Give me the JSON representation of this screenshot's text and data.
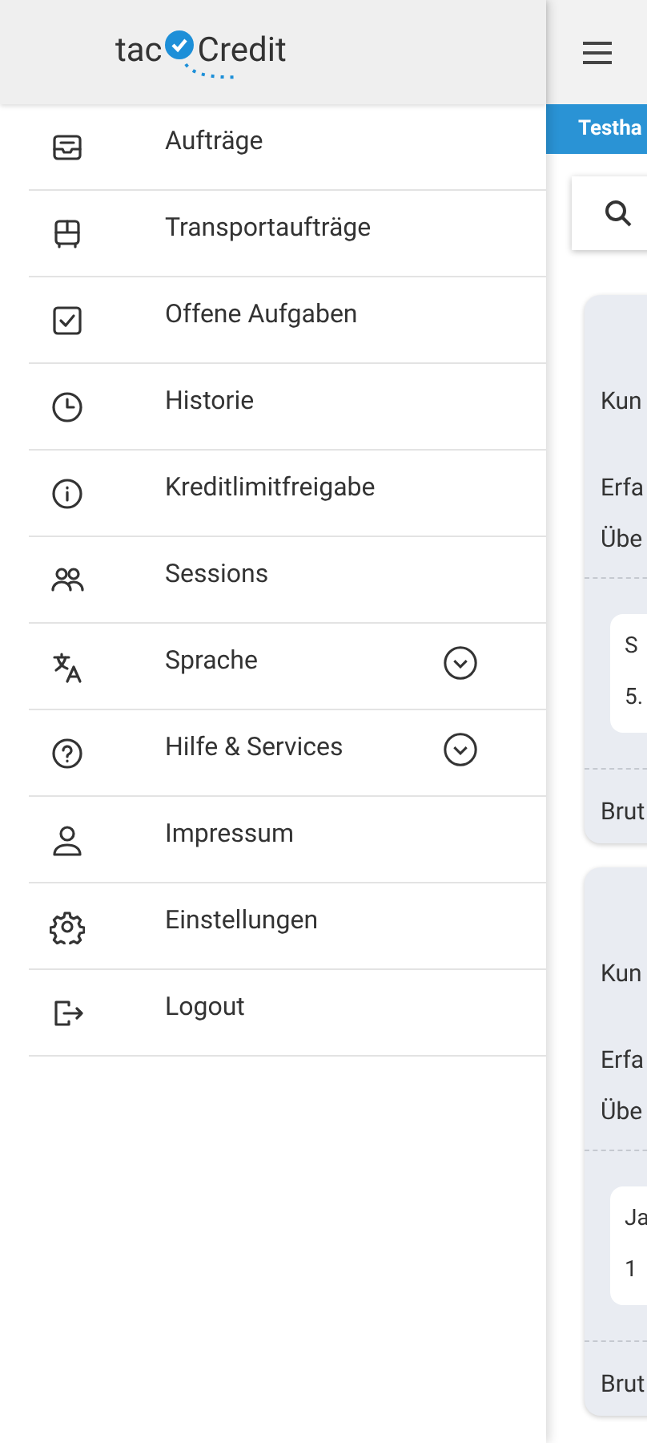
{
  "drawer": {
    "logo": {
      "left": "tac",
      "right": "Credit"
    },
    "items": [
      {
        "label": "Aufträge",
        "kind": "link"
      },
      {
        "label": "Transportaufträge",
        "kind": "link"
      },
      {
        "label": "Offene Aufgaben",
        "kind": "link"
      },
      {
        "label": "Historie",
        "kind": "link"
      },
      {
        "label": "Kreditlimitfreigabe",
        "kind": "link"
      },
      {
        "label": "Sessions",
        "kind": "link"
      },
      {
        "label": "Sprache",
        "kind": "expandable"
      },
      {
        "label": "Hilfe & Services",
        "kind": "expandable"
      },
      {
        "label": "Impressum",
        "kind": "link"
      },
      {
        "label": "Einstellungen",
        "kind": "link"
      },
      {
        "label": "Logout",
        "kind": "link"
      }
    ]
  },
  "main": {
    "banner": "Testha",
    "cards": [
      {
        "label_1": "Kun",
        "label_2": "Erfa",
        "label_3": "Übe",
        "box_line_1": "S",
        "box_line_2": "5.",
        "label_4": "Brut"
      },
      {
        "label_1": "Kun",
        "label_2": "Erfa",
        "label_3": "Übe",
        "box_line_1": "Ja",
        "box_line_2": "1",
        "label_4": "Brut"
      }
    ]
  }
}
